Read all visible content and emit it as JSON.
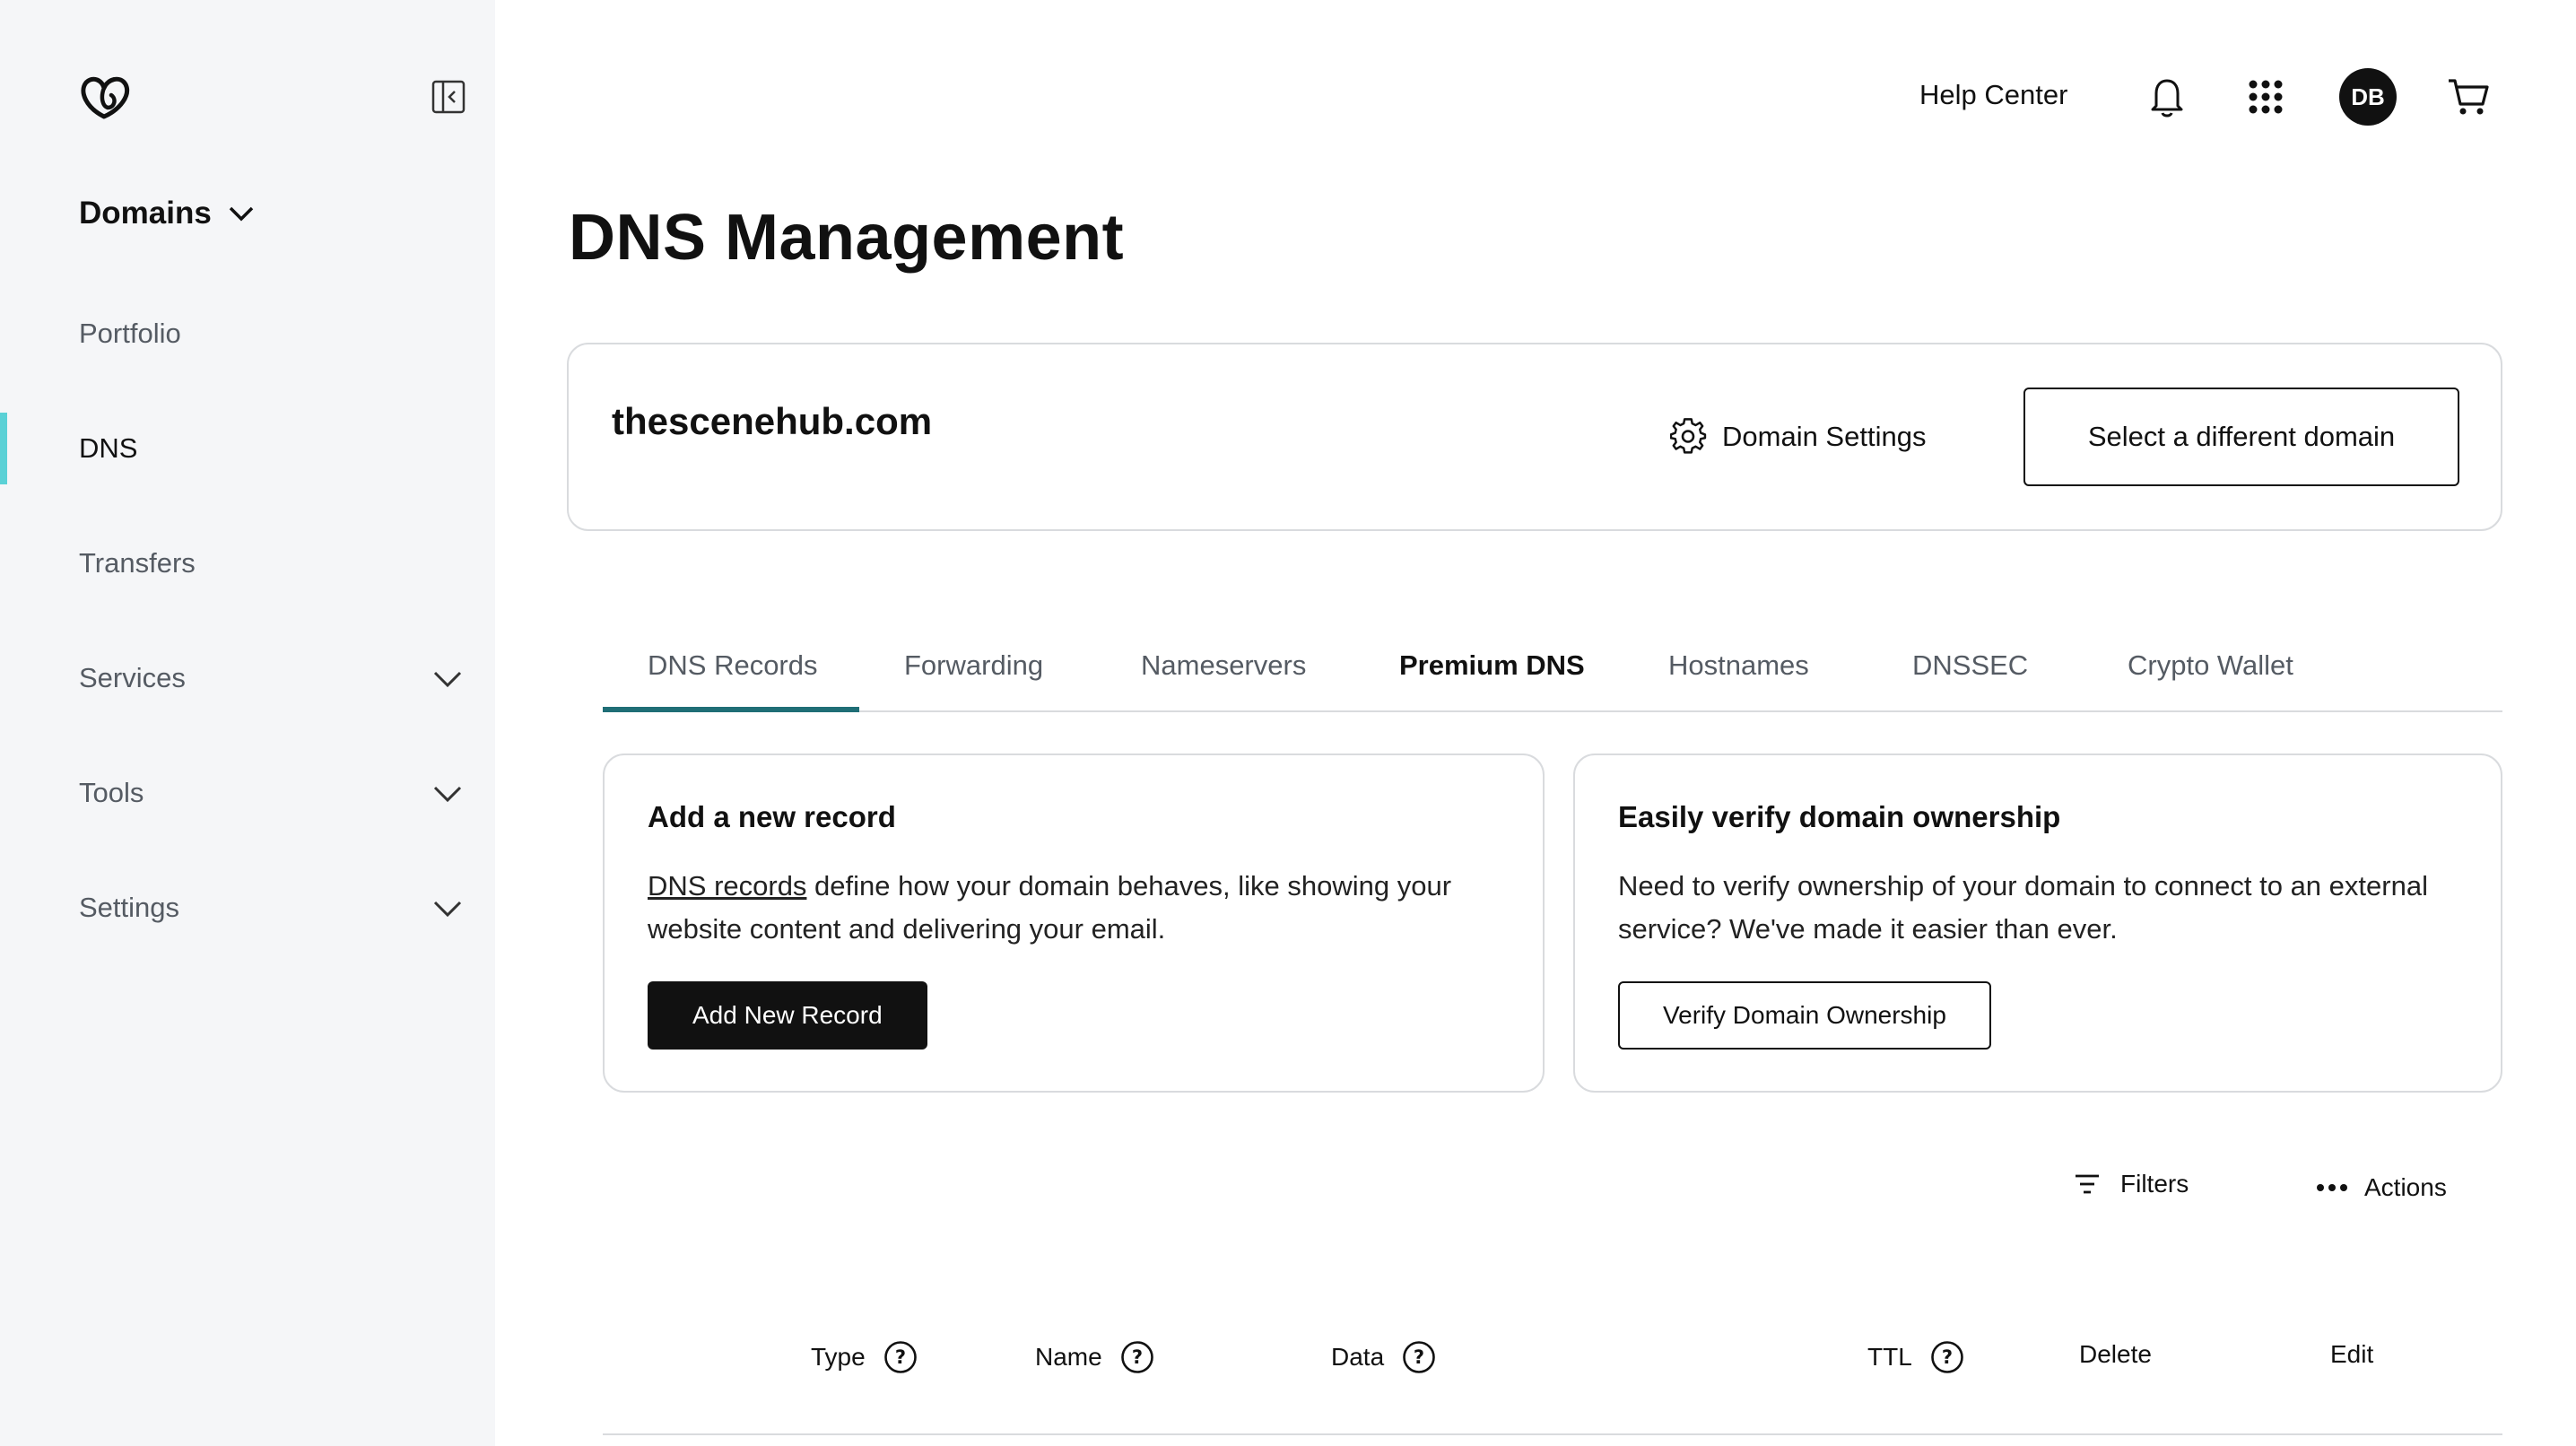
{
  "sidebar": {
    "title": "Domains",
    "items": [
      {
        "label": "Portfolio"
      },
      {
        "label": "DNS"
      },
      {
        "label": "Transfers"
      },
      {
        "label": "Services"
      },
      {
        "label": "Tools"
      },
      {
        "label": "Settings"
      }
    ]
  },
  "topbar": {
    "help_label": "Help Center",
    "avatar_initials": "DB"
  },
  "page": {
    "title": "DNS Management"
  },
  "domain_card": {
    "domain": "thescenehub.com",
    "settings_label": "Domain Settings",
    "select_label": "Select a different domain"
  },
  "tabs": [
    {
      "label": "DNS Records"
    },
    {
      "label": "Forwarding"
    },
    {
      "label": "Nameservers"
    },
    {
      "label": "Premium DNS"
    },
    {
      "label": "Hostnames"
    },
    {
      "label": "DNSSEC"
    },
    {
      "label": "Crypto Wallet"
    }
  ],
  "add_record": {
    "title": "Add a new record",
    "link_text": "DNS records",
    "desc_line1": " define how your domain behaves, like showing your",
    "desc_line2": "website content and delivering your email.",
    "button": "Add New Record"
  },
  "verify": {
    "title": "Easily verify domain ownership",
    "desc_line1": "Need to verify ownership of your domain to connect to an external",
    "desc_line2": "service? We've made it easier than ever.",
    "button": "Verify Domain Ownership"
  },
  "table": {
    "filters_label": "Filters",
    "actions_label": "Actions",
    "columns": [
      "Type",
      "Name",
      "Data",
      "TTL",
      "Delete",
      "Edit"
    ]
  },
  "colors": {
    "accent": "#5ad1d6",
    "tab_underline": "#1f6e76",
    "sidebar_bg": "#f5f6f8"
  },
  "icons": [
    "godaddy-logo",
    "sidebar-collapse-icon",
    "chevron-down-icon",
    "bell-icon",
    "apps-grid-icon",
    "cart-icon",
    "gear-icon",
    "filter-icon",
    "more-dots-icon",
    "help-circle-icon"
  ]
}
